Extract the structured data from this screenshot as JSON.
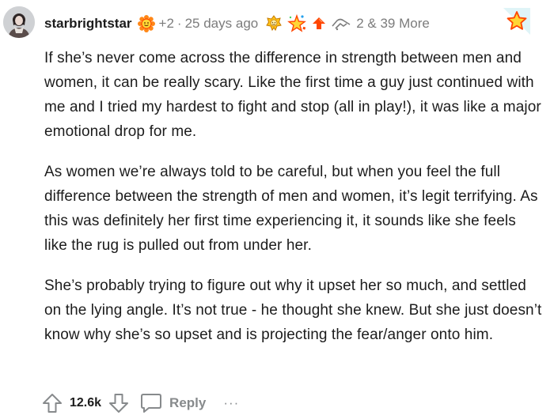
{
  "comment": {
    "username": "starbrightstar",
    "flair_count": "+2",
    "separator": "·",
    "time_ago": "25 days ago",
    "awards_label": "2 & 39 More",
    "paragraphs": [
      "If she’s never come across the difference in strength between men and women, it can be really scary. Like the first time a guy just continued with me and I tried my hardest to fight and stop (all in play!), it was like a major emotional drop for me.",
      "As women we’re always told to be careful, but when you feel the full difference between the strength of men and women, it’s legit terrifying. As this was definitely her first time experiencing it, it sounds like she feels like the rug is pulled out from under her.",
      "She’s probably trying to figure out why it upset her so much, and settled on the lying angle. It’s not true - he thought she knew. But she just doesn’t know why she’s so upset and is projecting the fear/anger onto him."
    ]
  },
  "actions": {
    "score": "12.6k",
    "reply_label": "Reply",
    "more_label": "···"
  },
  "icons": {
    "avatar": "user-avatar",
    "flair": "sunflower-flair-icon",
    "award_1": "gold-trophy-icon",
    "award_2": "star-burst-award-icon",
    "award_3": "red-arrow-award-icon",
    "award_4": "handshake-award-icon",
    "corner": "star-icon",
    "upvote": "upvote-arrow-icon",
    "downvote": "downvote-arrow-icon",
    "reply": "speech-bubble-icon"
  },
  "colors": {
    "text": "#1c1c1c",
    "meta": "#7c7c7c",
    "action_gray": "#878a8c",
    "award_orange": "#ff8717",
    "award_red": "#ff4500",
    "gold": "#ffc21a"
  }
}
